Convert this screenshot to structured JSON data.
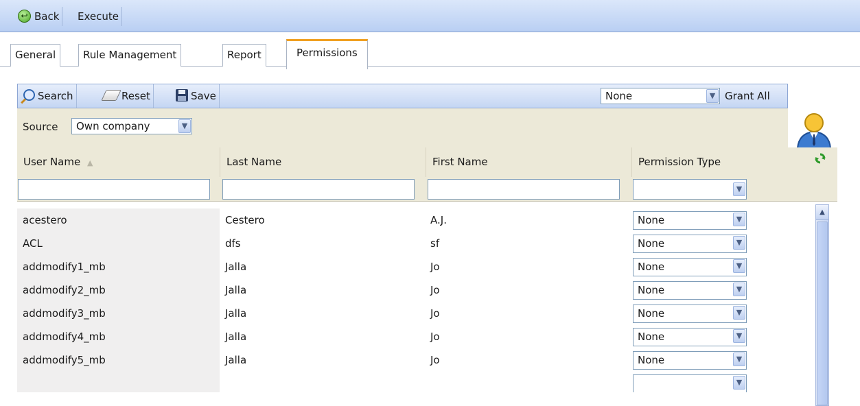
{
  "toolbar": {
    "back_label": "Back",
    "execute_label": "Execute"
  },
  "tabs": [
    {
      "label": "General"
    },
    {
      "label": "Rule Management"
    },
    {
      "label": "Report"
    },
    {
      "label": "Permissions"
    }
  ],
  "grid_toolbar": {
    "search_label": "Search",
    "reset_label": "Reset",
    "save_label": "Save",
    "grant_select_value": "None",
    "grant_all_label": "Grant All"
  },
  "source": {
    "label": "Source",
    "value": "Own company"
  },
  "columns": {
    "user_name": "User Name",
    "last_name": "Last Name",
    "first_name": "First Name",
    "permission_type": "Permission Type"
  },
  "rows": [
    {
      "user": "acestero",
      "last": "Cestero",
      "first": "A.J.",
      "perm": "None"
    },
    {
      "user": "ACL",
      "last": "dfs",
      "first": "sf",
      "perm": "None"
    },
    {
      "user": "addmodify1_mb",
      "last": "Jalla",
      "first": "Jo",
      "perm": "None"
    },
    {
      "user": "addmodify2_mb",
      "last": "Jalla",
      "first": "Jo",
      "perm": "None"
    },
    {
      "user": "addmodify3_mb",
      "last": "Jalla",
      "first": "Jo",
      "perm": "None"
    },
    {
      "user": "addmodify4_mb",
      "last": "Jalla",
      "first": "Jo",
      "perm": "None"
    },
    {
      "user": "addmodify5_mb",
      "last": "Jalla",
      "first": "Jo",
      "perm": "None"
    }
  ],
  "colors": {
    "toolbar": "#c9daf6",
    "header_bg": "#ece9d8",
    "active_tab_accent": "#f0a020"
  },
  "icons": [
    "back-icon",
    "search-icon",
    "reset-icon",
    "save-icon",
    "user-avatar-icon",
    "refresh-icon",
    "chevron-down-icon",
    "scroll-up-icon",
    "sort-asc-icon"
  ]
}
